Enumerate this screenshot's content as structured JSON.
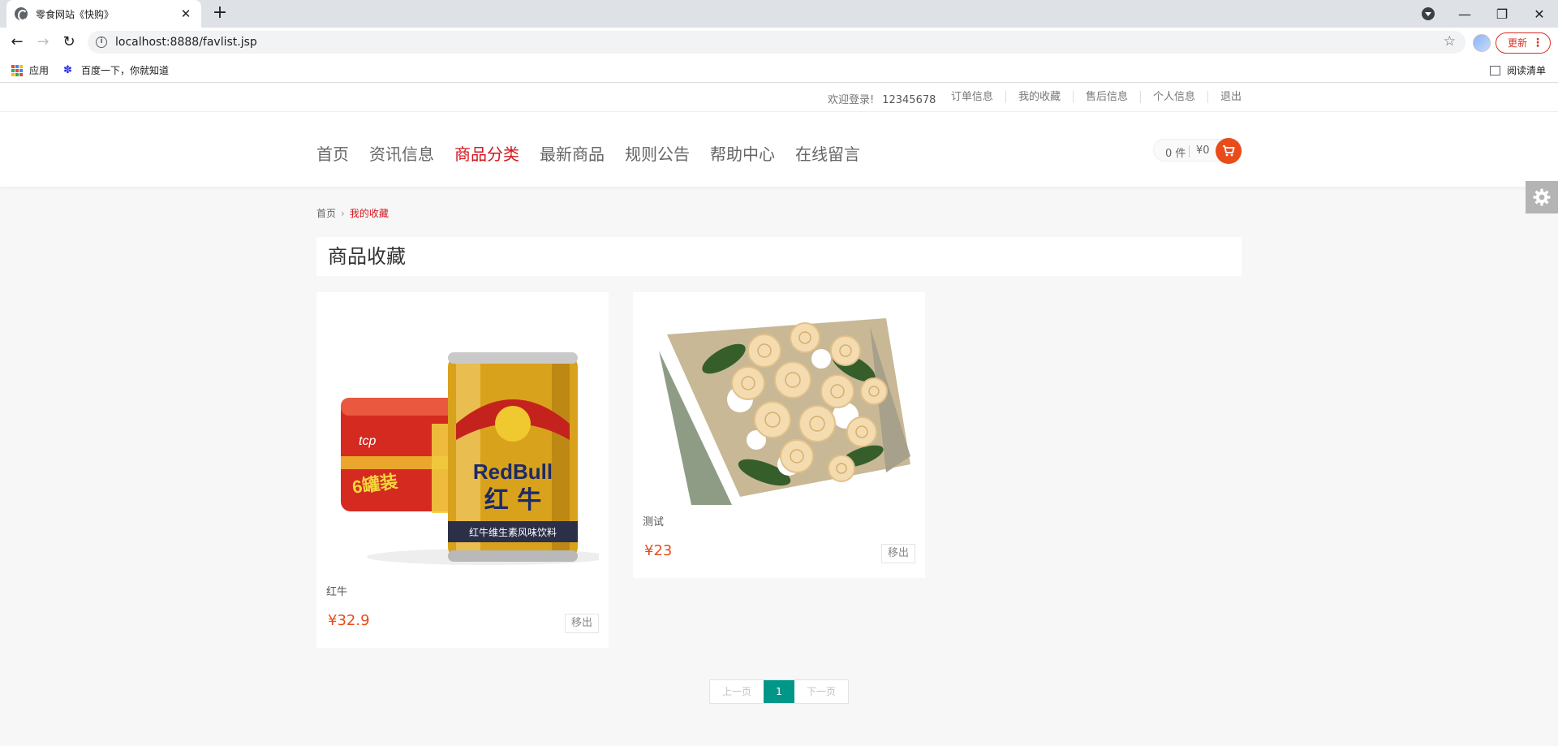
{
  "browser": {
    "tab_title": "零食网站《快购》",
    "tab_close": "✕",
    "new_tab": "+",
    "url": "localhost:8888/favlist.jsp",
    "update_label": "更新",
    "update_menu": "⋮",
    "bookmarks": [
      "应用",
      "百度一下，你就知道"
    ],
    "reading_list": "阅读清单",
    "nav": {
      "back": "←",
      "forward": "→",
      "reload": "↻"
    },
    "window": {
      "minimize": "—",
      "restore": "❐",
      "close": "✕"
    }
  },
  "topbar": {
    "welcome": "欢迎登录!",
    "username": "12345678",
    "links": [
      "订单信息",
      "我的收藏",
      "售后信息",
      "个人信息",
      "退出"
    ]
  },
  "nav": {
    "items": [
      "首页",
      "资讯信息",
      "商品分类",
      "最新商品",
      "规则公告",
      "帮助中心",
      "在线留言"
    ],
    "active_index": 2
  },
  "cart": {
    "count": "0 件",
    "amount": "¥0"
  },
  "breadcrumb": {
    "home": "首页",
    "separator": "›",
    "current": "我的收藏"
  },
  "section_title": "商品收藏",
  "products": [
    {
      "name": "红牛",
      "price": "¥32.9",
      "remove": "移出",
      "image_text": "RedBull",
      "image_text2": "红 牛",
      "image_text3": "红牛维生素风味饮料"
    },
    {
      "name": "测试",
      "price": "¥23",
      "remove": "移出"
    }
  ],
  "pager": {
    "prev": "上一页",
    "current": "1",
    "next": "下一页"
  },
  "colors": {
    "accent": "#d4161f",
    "price": "#e84c1b",
    "pager_active": "#009688"
  }
}
